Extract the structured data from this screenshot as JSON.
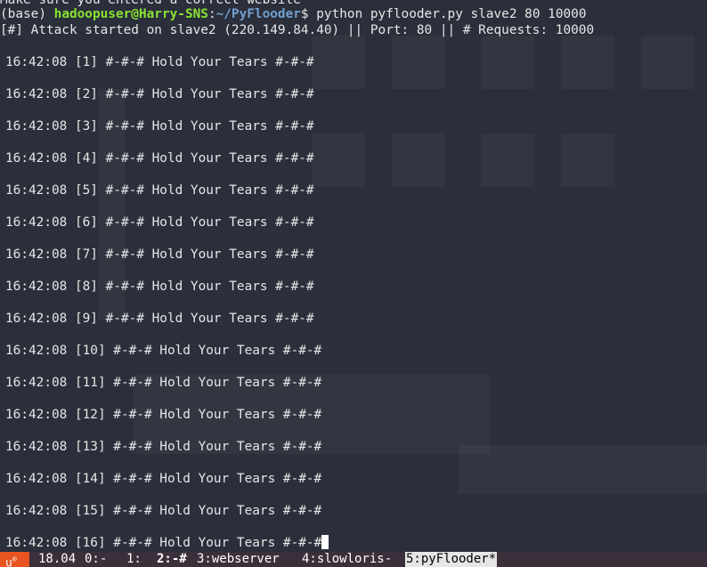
{
  "terminal": {
    "partial_top_line": "Make sure you entered a correct website",
    "prompt_env": "(base) ",
    "prompt_user": "hadoopuser@Harry-SNS",
    "prompt_sep": ":",
    "prompt_path": "~/PyFlooder",
    "prompt_symbol": "$ ",
    "command": "python pyflooder.py slave2 80 10000",
    "attack_info": "[#] Attack started on slave2 (220.149.84.40) || Port: 80 || # Requests: 10000",
    "log_lines": [
      "16:42:08 [1] #-#-# Hold Your Tears #-#-#",
      "16:42:08 [2] #-#-# Hold Your Tears #-#-#",
      "16:42:08 [3] #-#-# Hold Your Tears #-#-#",
      "16:42:08 [4] #-#-# Hold Your Tears #-#-#",
      "16:42:08 [5] #-#-# Hold Your Tears #-#-#",
      "16:42:08 [6] #-#-# Hold Your Tears #-#-#",
      "16:42:08 [7] #-#-# Hold Your Tears #-#-#",
      "16:42:08 [8] #-#-# Hold Your Tears #-#-#",
      "16:42:08 [9] #-#-# Hold Your Tears #-#-#",
      "16:42:08 [10] #-#-# Hold Your Tears #-#-#",
      "16:42:08 [11] #-#-# Hold Your Tears #-#-#",
      "16:42:08 [12] #-#-# Hold Your Tears #-#-#",
      "16:42:08 [13] #-#-# Hold Your Tears #-#-#",
      "16:42:08 [14] #-#-# Hold Your Tears #-#-#",
      "16:42:08 [15] #-#-# Hold Your Tears #-#-#",
      "16:42:08 [16] #-#-# Hold Your Tears #-#-#"
    ]
  },
  "statusbar": {
    "logo": "u",
    "logo_mark": "®",
    "version": "18.04",
    "windows": [
      {
        "label": "0:-",
        "active": false
      },
      {
        "label": "1:",
        "active": false
      },
      {
        "label": "2:-#",
        "active": false,
        "bold": true
      },
      {
        "label": "3:webserver",
        "active": false
      },
      {
        "label": "4:slowloris-",
        "active": false
      },
      {
        "label": "5:pyFlooder*",
        "active": true
      }
    ]
  },
  "colors": {
    "background": "#2a2f3b",
    "text": "#e6e6e6",
    "user": "#8ae234",
    "path": "#729fcf",
    "status_bg": "#3b2f3b",
    "status_logo": "#e95420"
  }
}
